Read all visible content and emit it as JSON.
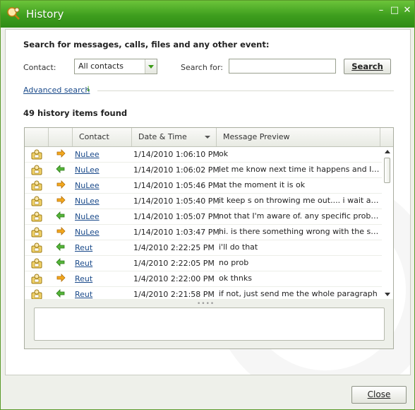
{
  "window": {
    "title": "History"
  },
  "search": {
    "heading": "Search for messages, calls, files and any other event:",
    "contact_label": "Contact:",
    "contact_value": "All contacts",
    "search_for_label": "Search for:",
    "search_value": "",
    "search_button": "Search",
    "advanced_label": "Advanced search"
  },
  "results": {
    "found_text": "49 history items found"
  },
  "table": {
    "columns": [
      "Contact",
      "Date & Time",
      "Message Preview"
    ],
    "rows": [
      {
        "direction": "out",
        "contact": "NuLee",
        "datetime": "1/14/2010 1:06:10 PM",
        "message": "ok"
      },
      {
        "direction": "in",
        "contact": "NuLee",
        "datetime": "1/14/2010 1:06:02 PM",
        "message": "let me know next time it happens and I'll com..."
      },
      {
        "direction": "out",
        "contact": "NuLee",
        "datetime": "1/14/2010 1:05:46 PM",
        "message": "at the moment it is ok"
      },
      {
        "direction": "out",
        "contact": "NuLee",
        "datetime": "1/14/2010 1:05:40 PM",
        "message": "it keep s on throwing me out.... i wait a bit t..."
      },
      {
        "direction": "in",
        "contact": "NuLee",
        "datetime": "1/14/2010 1:05:07 PM",
        "message": "not that I'm aware of. any specific problem?..."
      },
      {
        "direction": "out",
        "contact": "NuLee",
        "datetime": "1/14/2010 1:03:47 PM",
        "message": "hi. is there something wrong with the server ..."
      },
      {
        "direction": "in",
        "contact": "Reut",
        "datetime": "1/4/2010 2:22:25 PM",
        "message": "i'll do that"
      },
      {
        "direction": "in",
        "contact": "Reut",
        "datetime": "1/4/2010 2:22:05 PM",
        "message": "no prob"
      },
      {
        "direction": "out",
        "contact": "Reut",
        "datetime": "1/4/2010 2:22:00 PM",
        "message": "ok thnks"
      },
      {
        "direction": "in",
        "contact": "Reut",
        "datetime": "1/4/2010 2:21:58 PM",
        "message": "if not, just send me the whole paragraph"
      }
    ]
  },
  "footer": {
    "close_button": "Close"
  },
  "colors": {
    "accent": "#3e9e1e",
    "link": "#1a4a8a",
    "outgoing": "#f0a020",
    "incoming": "#3aa02a"
  },
  "icons": {
    "app": "history-icon",
    "user": "user-contact-icon",
    "out": "outgoing-arrow-icon",
    "in": "incoming-arrow-icon"
  }
}
